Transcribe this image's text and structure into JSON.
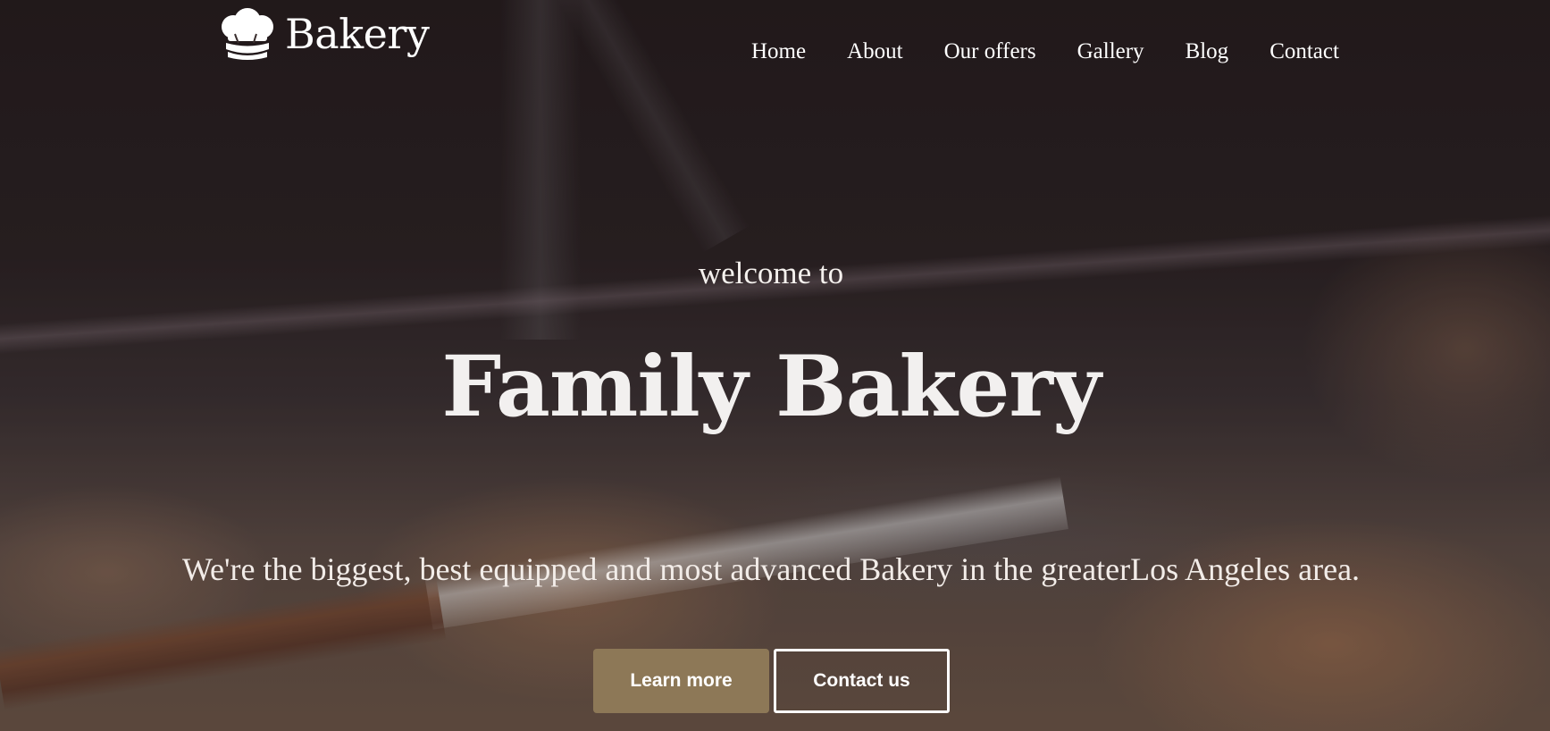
{
  "brand": {
    "logo_icon": "chef-hat-icon",
    "name": "Bakery"
  },
  "nav": {
    "items": [
      {
        "label": "Home"
      },
      {
        "label": "About"
      },
      {
        "label": "Our offers"
      },
      {
        "label": "Gallery"
      },
      {
        "label": "Blog"
      },
      {
        "label": "Contact"
      }
    ]
  },
  "hero": {
    "kicker": "welcome to",
    "title": "Family Bakery",
    "tagline": "We're the biggest, best equipped and most advanced Bakery in the greaterLos Angeles area.",
    "primary_button": "Learn more",
    "secondary_button": "Contact us"
  },
  "colors": {
    "accent_button": "#8d7857",
    "text": "#ffffff"
  }
}
